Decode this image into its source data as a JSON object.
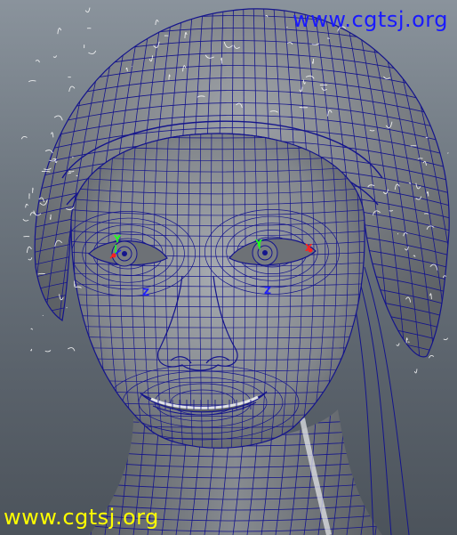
{
  "watermark": {
    "top_text": "www.cgtsj.org",
    "bottom_text": "www.cgtsj.org"
  },
  "viewport": {
    "subject": "3d-head-wireframe",
    "colors": {
      "background_top": "#8a939c",
      "background_bottom": "#4c535b",
      "mesh_surface": "#8b8f94",
      "wire": "#14148c",
      "hair_strands": "#ffffff"
    }
  },
  "manipulators": {
    "left_eye": {
      "y_label": "Y",
      "x_label": "X",
      "z_label": "Z"
    },
    "right_eye": {
      "y_label": "Y",
      "x_label": "X",
      "z_label": "Z"
    },
    "colors": {
      "x": "#ff2020",
      "y": "#20ff20",
      "z": "#2020ff"
    }
  }
}
